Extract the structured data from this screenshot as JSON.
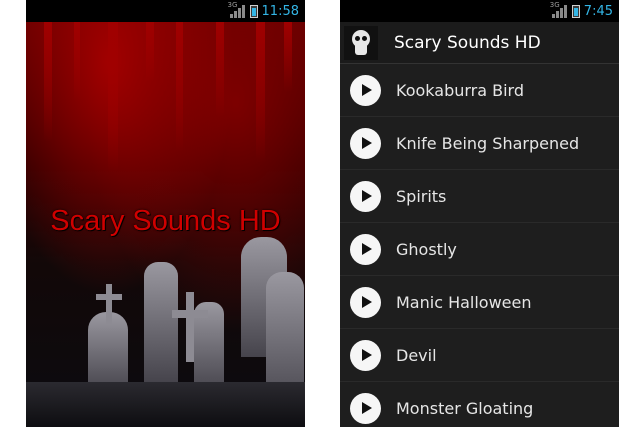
{
  "left_screen": {
    "status": {
      "network": "3G",
      "time": "11:58"
    },
    "splash_title": "Scary Sounds HD"
  },
  "right_screen": {
    "status": {
      "network": "3G",
      "time": "7:45"
    },
    "app_title": "Scary Sounds HD",
    "sounds": [
      {
        "label": "Kookaburra Bird"
      },
      {
        "label": "Knife Being Sharpened"
      },
      {
        "label": "Spirits"
      },
      {
        "label": "Ghostly"
      },
      {
        "label": "Manic Halloween"
      },
      {
        "label": "Devil"
      },
      {
        "label": "Monster Gloating"
      }
    ]
  },
  "colors": {
    "status_accent": "#33b5e5",
    "splash_title": "#d00000",
    "list_background": "#1e1e1e",
    "play_button": "#f6f6f6"
  }
}
